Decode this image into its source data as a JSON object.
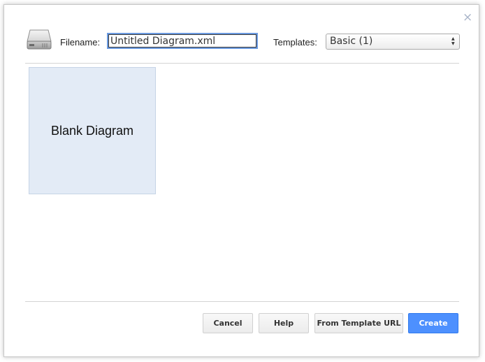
{
  "dialog": {
    "close_symbol": "×",
    "icons": {
      "close": "close-icon",
      "drive": "hard-drive-icon"
    }
  },
  "filename": {
    "label": "Filename:",
    "value": "Untitled Diagram.xml"
  },
  "templates": {
    "label": "Templates:",
    "selected": "Basic (1)"
  },
  "template_tiles": [
    {
      "label": "Blank Diagram"
    }
  ],
  "buttons": {
    "cancel": "Cancel",
    "help": "Help",
    "from_template_url": "From Template URL",
    "create": "Create"
  },
  "colors": {
    "accent": "#4d90fe",
    "tile_background": "#e3ebf6"
  }
}
